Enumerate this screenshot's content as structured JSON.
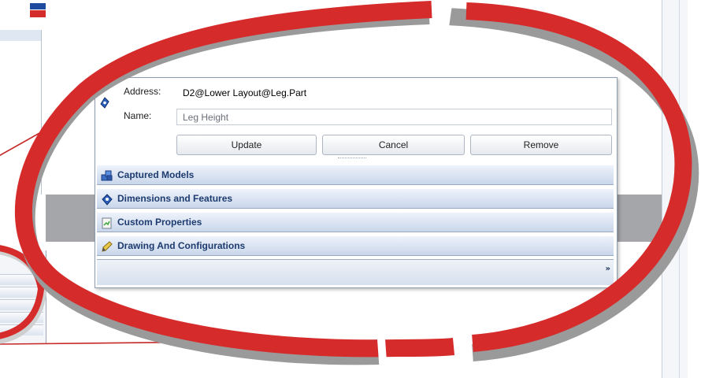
{
  "panel": {
    "address_label": "Address:",
    "address_value": "D2@Lower Layout@Leg.Part",
    "name_label": "Name:",
    "name_value": "Leg Height",
    "buttons": {
      "update": "Update",
      "cancel": "Cancel",
      "remove": "Remove"
    },
    "sections": [
      {
        "label": "Captured Models",
        "icon": "captured-models-icon"
      },
      {
        "label": "Dimensions and Features",
        "icon": "dimension-icon"
      },
      {
        "label": "Custom Properties",
        "icon": "properties-icon"
      },
      {
        "label": "Drawing And Configurations",
        "icon": "drawing-icon"
      }
    ],
    "footer_chevron": "»"
  },
  "colors": {
    "ring": "#d62b2b",
    "ring_shadow": "#9a9a9a",
    "section_text": "#1d3b6f",
    "section_top": "#eef3fb",
    "section_bottom": "#c9d6ea"
  }
}
